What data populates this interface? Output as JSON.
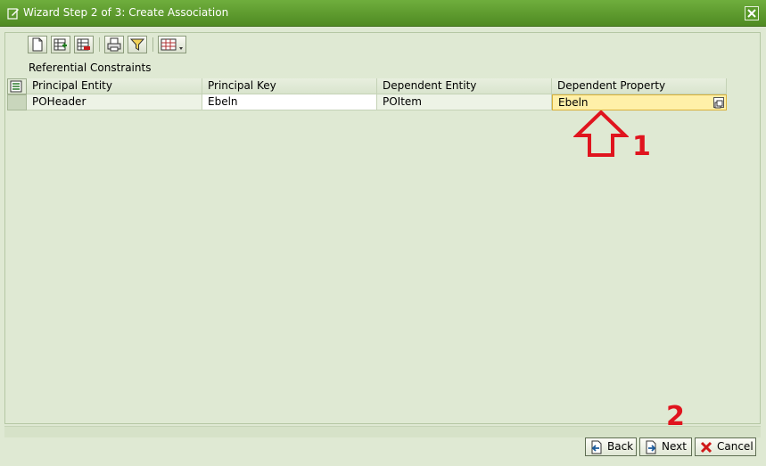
{
  "window": {
    "title": "Wizard Step 2 of 3: Create Association",
    "title_icon": "wizard-edit-icon",
    "close_icon": "close-icon"
  },
  "toolbar": {
    "icons": [
      "new-document-icon",
      "insert-row-icon",
      "delete-row-icon",
      "print-icon",
      "filter-icon",
      "layout-menu-icon"
    ]
  },
  "section": {
    "label": "Referential Constraints"
  },
  "table": {
    "columns": [
      "Principal Entity",
      "Principal Key",
      "Dependent Entity",
      "Dependent Property"
    ],
    "rows": [
      [
        "POHeader",
        "Ebeln",
        "POItem",
        "Ebeln"
      ]
    ]
  },
  "annotations": {
    "marker1": "1",
    "marker2": "2"
  },
  "buttons": {
    "back": "Back",
    "next": "Next",
    "cancel": "Cancel"
  },
  "colors": {
    "titlebar": "#5a9a2a",
    "background": "#dfe9d3",
    "annotation": "#e0141e",
    "selected_cell": "#fff0a8"
  }
}
